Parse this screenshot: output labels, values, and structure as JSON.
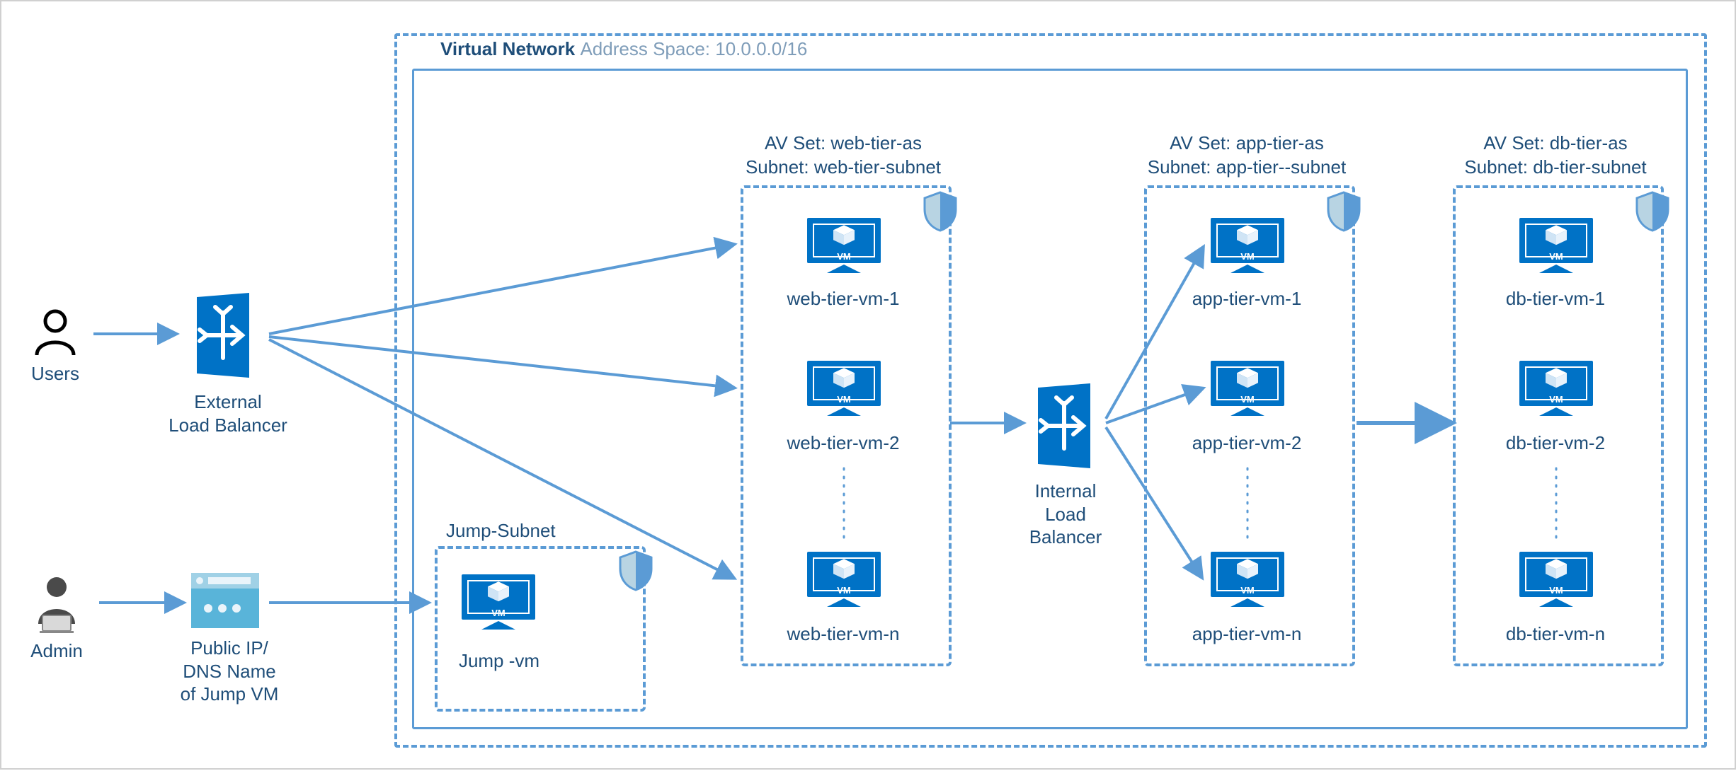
{
  "vnet": {
    "title_bold": "Virtual Network ",
    "title_light": "Address Space: 10.0.0.0/16"
  },
  "users_label": "Users",
  "admin_label": "Admin",
  "external_lb_label": "External\nLoad Balancer",
  "internal_lb_label": "Internal\nLoad\nBalancer",
  "public_ip_label": "Public IP/\nDNS Name\nof Jump VM",
  "jump_subnet_label": "Jump-Subnet",
  "jump_vm_label": "Jump -vm",
  "tiers": {
    "web": {
      "header1": "AV Set: web-tier-as",
      "header2": "Subnet: web-tier-subnet",
      "vms": [
        "web-tier-vm-1",
        "web-tier-vm-2",
        "web-tier-vm-n"
      ]
    },
    "app": {
      "header1": "AV Set: app-tier-as",
      "header2": "Subnet: app-tier--subnet",
      "vms": [
        "app-tier-vm-1",
        "app-tier-vm-2",
        "app-tier-vm-n"
      ]
    },
    "db": {
      "header1": "AV Set: db-tier-as",
      "header2": "Subnet: db-tier-subnet",
      "vms": [
        "db-tier-vm-1",
        "db-tier-vm-2",
        "db-tier-vm-n"
      ]
    }
  }
}
